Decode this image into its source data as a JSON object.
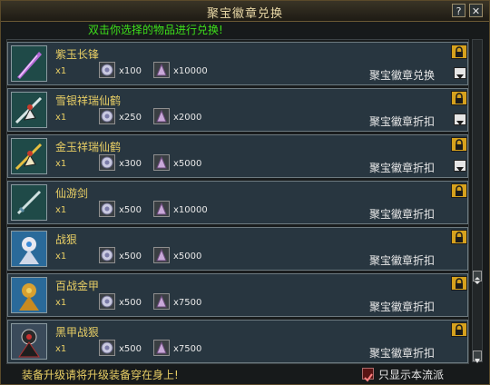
{
  "window": {
    "title": "聚宝徽章兑换",
    "help_label": "?",
    "close_label": "✕"
  },
  "hint": "双击你选择的物品进行兑换!",
  "items": [
    {
      "name": "紫玉长锋",
      "qty": "x1",
      "cost1": "x100",
      "cost2": "x10000",
      "action": "聚宝徽章兑换",
      "icon": "purple-blade-icon"
    },
    {
      "name": "雪银祥瑞仙鹤",
      "qty": "x1",
      "cost1": "x250",
      "cost2": "x2000",
      "action": "聚宝徽章折扣",
      "icon": "silver-crane-icon"
    },
    {
      "name": "金玉祥瑞仙鹤",
      "qty": "x1",
      "cost1": "x300",
      "cost2": "x5000",
      "action": "聚宝徽章折扣",
      "icon": "golden-crane-icon"
    },
    {
      "name": "仙游剑",
      "qty": "x1",
      "cost1": "x500",
      "cost2": "x10000",
      "action": "聚宝徽章折扣",
      "icon": "sword-icon"
    },
    {
      "name": "战狠",
      "qty": "x1",
      "cost1": "x500",
      "cost2": "x5000",
      "action": "聚宝徽章折扣",
      "icon": "armor-icon"
    },
    {
      "name": "百战金甲",
      "qty": "x1",
      "cost1": "x500",
      "cost2": "x7500",
      "action": "聚宝徽章折扣",
      "icon": "gold-armor-icon"
    },
    {
      "name": "黑甲战狠",
      "qty": "x1",
      "cost1": "x500",
      "cost2": "x7500",
      "action": "聚宝徽章折扣",
      "icon": "black-armor-icon"
    }
  ],
  "footer": {
    "notice": "装备升级请将升级装备穿在身上!",
    "checkbox_label": "只显示本流派",
    "checkbox_checked": true
  }
}
